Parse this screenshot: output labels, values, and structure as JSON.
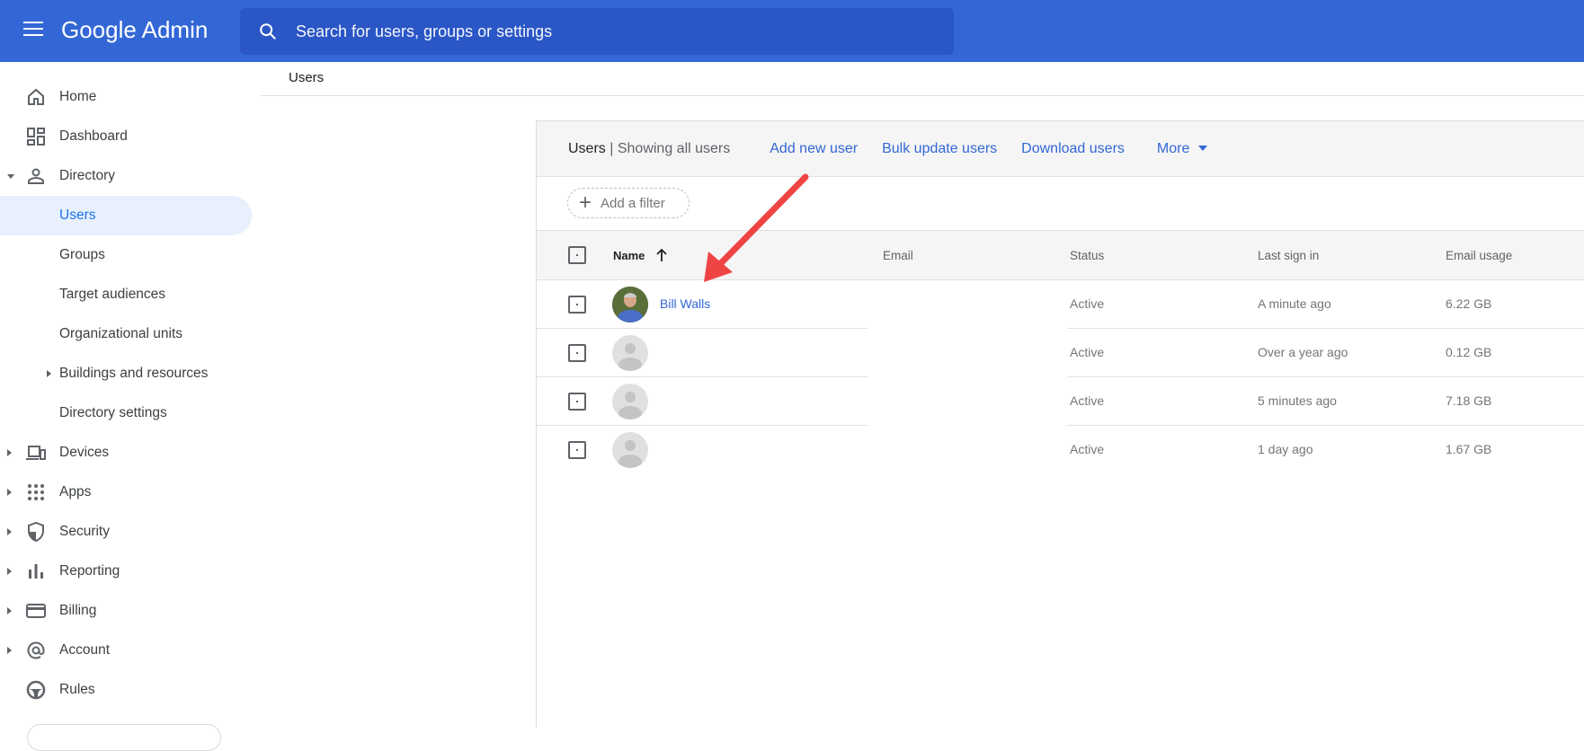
{
  "header": {
    "app_title": "Google Admin",
    "search_placeholder": "Search for users, groups or settings"
  },
  "sidebar": {
    "items": [
      {
        "label": "Home",
        "icon": "home-icon"
      },
      {
        "label": "Dashboard",
        "icon": "dashboard-icon"
      },
      {
        "label": "Directory",
        "icon": "person-icon"
      },
      {
        "label": "Users"
      },
      {
        "label": "Groups"
      },
      {
        "label": "Target audiences"
      },
      {
        "label": "Organizational units"
      },
      {
        "label": "Buildings and resources"
      },
      {
        "label": "Directory settings"
      },
      {
        "label": "Devices",
        "icon": "devices-icon"
      },
      {
        "label": "Apps",
        "icon": "apps-grid-icon"
      },
      {
        "label": "Security",
        "icon": "shield-icon"
      },
      {
        "label": "Reporting",
        "icon": "bar-chart-icon"
      },
      {
        "label": "Billing",
        "icon": "credit-card-icon"
      },
      {
        "label": "Account",
        "icon": "at-sign-icon"
      },
      {
        "label": "Rules",
        "icon": "steering-wheel-icon"
      }
    ]
  },
  "breadcrumb": "Users",
  "card": {
    "title": "Users",
    "separator": "|",
    "subtitle": "Showing all users",
    "actions": [
      "Add new user",
      "Bulk update users",
      "Download users",
      "More"
    ],
    "filter_label": "Add a filter"
  },
  "table": {
    "columns": [
      "Name",
      "Email",
      "Status",
      "Last sign in",
      "Email usage"
    ],
    "rows": [
      {
        "name": "Bill Walls",
        "status": "Active",
        "last_sign_in": "A minute ago",
        "email_usage": "6.22 GB"
      },
      {
        "name": "",
        "status": "Active",
        "last_sign_in": "Over a year ago",
        "email_usage": "0.12 GB"
      },
      {
        "name": "",
        "status": "Active",
        "last_sign_in": "5 minutes ago",
        "email_usage": "7.18 GB"
      },
      {
        "name": "",
        "status": "Active",
        "last_sign_in": "1 day ago",
        "email_usage": "1.67 GB"
      }
    ]
  },
  "colors": {
    "header": "#3367d6",
    "search": "#2a56c6",
    "link": "#3367d6",
    "annotation_arrow": "#ef4444"
  }
}
